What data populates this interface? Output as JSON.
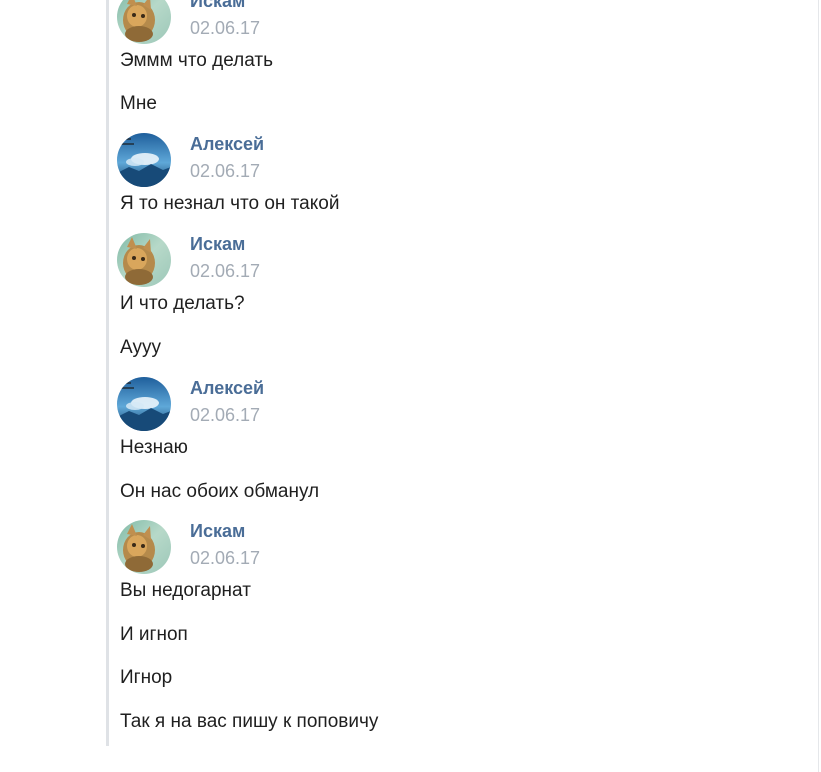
{
  "messages": [
    {
      "author": "Искам",
      "date": "02.06.17",
      "avatar": "cat-avatar",
      "lines": [
        "Эммм что делать",
        "Мне"
      ]
    },
    {
      "author": "Алексей",
      "date": "02.06.17",
      "avatar": "sky-avatar",
      "lines": [
        "Я то незнал что он такой"
      ]
    },
    {
      "author": "Искам",
      "date": "02.06.17",
      "avatar": "cat-avatar",
      "lines": [
        "И что делать?",
        "Ауyy"
      ]
    },
    {
      "author": "Алексей",
      "date": "02.06.17",
      "avatar": "sky-avatar",
      "lines": [
        "Незнаю",
        "Он нас обоих обманул"
      ]
    },
    {
      "author": "Искам",
      "date": "02.06.17",
      "avatar": "cat-avatar",
      "lines": [
        "Вы недогарнат",
        "И игноп",
        "Игнор",
        "Так я на вас пишу к поповичу"
      ]
    }
  ],
  "colors": {
    "author": "#4a6d97",
    "date": "#a3abb5",
    "text": "#1f1f1f",
    "rule": "#dfe2e6"
  }
}
